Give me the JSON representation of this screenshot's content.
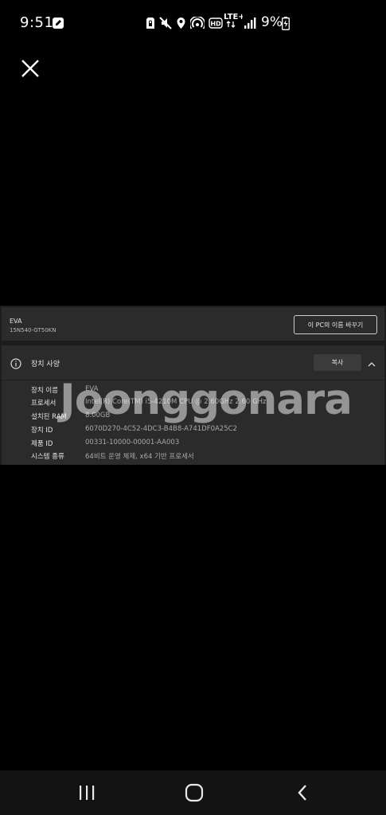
{
  "status_bar": {
    "time": "9:51",
    "battery_percent": "9%",
    "network": "LTE+",
    "icons": [
      "edit-square-icon",
      "sim-lock-icon",
      "mute-icon",
      "location-icon",
      "hotspot-icon",
      "hd-voice-icon",
      "lte-icon",
      "signal-icon",
      "battery-charging-icon"
    ]
  },
  "overlay": {
    "close_icon": "close-icon"
  },
  "device_card": {
    "device_name": "EVA",
    "model": "15N540-GT50KN",
    "rename_button": "이 PC의 이름 바꾸기"
  },
  "specs": {
    "title": "장치 사양",
    "copy_button": "복사",
    "rows": [
      {
        "label": "장치 이름",
        "value": "EVA"
      },
      {
        "label": "프로세서",
        "value": "Intel(R) Core(TM) i5-4210M CPU @ 2.60GHz   2.60 GHz"
      },
      {
        "label": "설치된 RAM",
        "value": "8.00GB"
      },
      {
        "label": "장치 ID",
        "value": "6070D270-4C52-4DC3-B4B8-A741DF0A25C2"
      },
      {
        "label": "제품 ID",
        "value": "00331-10000-00001-AA003"
      },
      {
        "label": "시스템 종류",
        "value": "64비트 운영 체제, x64 기반 프로세서"
      }
    ]
  },
  "watermark": "Joonggonara",
  "nav_bar": {
    "buttons": [
      "recent-apps-icon",
      "home-icon",
      "back-icon"
    ]
  }
}
